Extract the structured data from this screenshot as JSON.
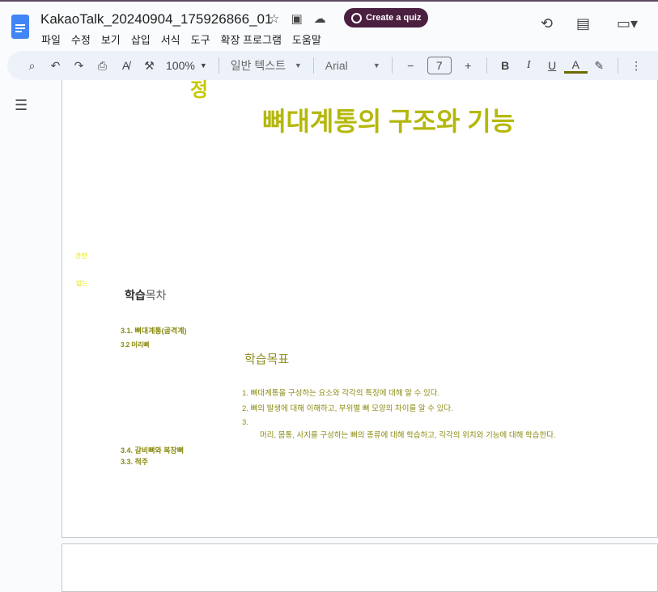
{
  "header": {
    "title": "KakaoTalk_20240904_175926866_01",
    "quiz_button": "Create a quiz",
    "menu": [
      "파일",
      "수정",
      "보기",
      "삽입",
      "서식",
      "도구",
      "확장 프로그램",
      "도움말"
    ]
  },
  "toolbar": {
    "zoom": "100%",
    "style": "일반 텍스트",
    "font": "Arial",
    "font_size": "7"
  },
  "doc": {
    "fragment": "정",
    "heading": "뼈대계통의 구조와 기능",
    "side1": "관련",
    "side2": "없는",
    "toc_title_bold": "학습",
    "toc_title_rest": "목차",
    "toc1": "3.1. 뼈대계통(골격계)",
    "toc2": "3.2 머리뼈",
    "goal_title": "학습목표",
    "goals": [
      "1. 뼈대계통을 구성하는 요소와 각각의 특징에 대해 알 수 있다.",
      "2. 뼈의 발생에 대해 이해하고, 부위별 뼈 모양의 차이를 알 수 있다.",
      "3."
    ],
    "goal3_text": "머리, 몸통, 사지를 구성하는 뼈의 종류에 대해 학습하고, 각각의 위치와 기능에 대해 학습한다.",
    "toc4": "3.4. 갈비뼈와 복장뼈",
    "toc3": "3.3. 척주"
  }
}
